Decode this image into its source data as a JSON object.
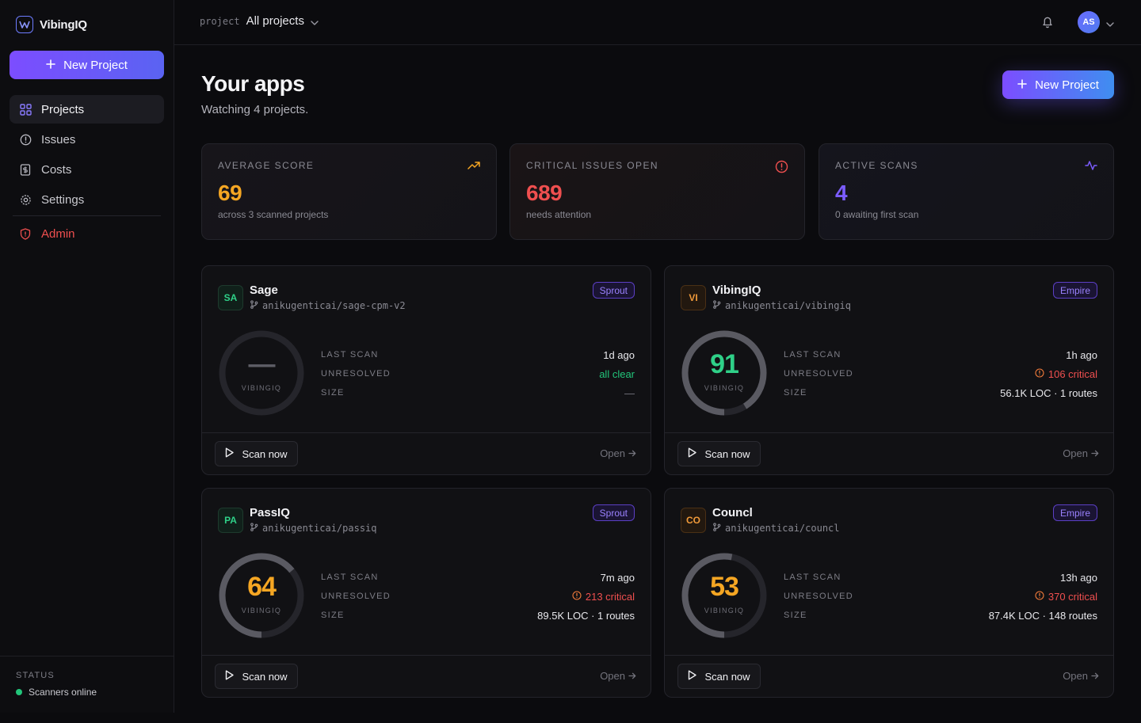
{
  "app": {
    "name": "VibingIQ"
  },
  "sidebar": {
    "new_project": "New Project",
    "items": [
      {
        "label": "Projects",
        "icon": "grid-icon",
        "active": true
      },
      {
        "label": "Issues",
        "icon": "alert-circle-icon"
      },
      {
        "label": "Costs",
        "icon": "receipt-icon"
      },
      {
        "label": "Settings",
        "icon": "gear-icon"
      }
    ],
    "admin": "Admin",
    "status": {
      "title": "STATUS",
      "text": "Scanners online"
    }
  },
  "topbar": {
    "project_label": "project",
    "project_value": "All projects",
    "avatar": "AS"
  },
  "header": {
    "title": "Your apps",
    "subtitle": "Watching 4 projects.",
    "new_project": "New Project"
  },
  "stats": [
    {
      "label": "AVERAGE SCORE",
      "value": "69",
      "sub": "across 3 scanned projects",
      "color": "#f5a623",
      "icon": "trending-up-icon"
    },
    {
      "label": "CRITICAL ISSUES OPEN",
      "value": "689",
      "sub": "needs attention",
      "color": "#ef4f4f",
      "icon": "alert-circle-icon"
    },
    {
      "label": "ACTIVE SCANS",
      "value": "4",
      "sub": "0 awaiting first scan",
      "color": "#7b5cff",
      "icon": "activity-icon"
    }
  ],
  "labels": {
    "last_scan": "LAST SCAN",
    "unresolved": "UNRESOLVED",
    "size": "SIZE",
    "gauge": "VIBINGIQ",
    "scan_now": "Scan now",
    "open": "Open"
  },
  "projects": [
    {
      "initials": "SA",
      "name": "Sage",
      "repo": "anikugenticai/sage-cpm-v2",
      "tier": "Sprout",
      "score": "—",
      "score_pct": 0,
      "last_scan": "1d ago",
      "unresolved": "all clear",
      "size": "—"
    },
    {
      "initials": "VI",
      "name": "VibingIQ",
      "repo": "anikugenticai/vibingiq",
      "tier": "Empire",
      "score": "91",
      "score_pct": 91,
      "last_scan": "1h ago",
      "unresolved": "106 critical",
      "size": "56.1K LOC · 1 routes"
    },
    {
      "initials": "PA",
      "name": "PassIQ",
      "repo": "anikugenticai/passiq",
      "tier": "Sprout",
      "score": "64",
      "score_pct": 64,
      "last_scan": "7m ago",
      "unresolved": "213 critical",
      "size": "89.5K LOC · 1 routes"
    },
    {
      "initials": "CO",
      "name": "Councl",
      "repo": "anikugenticai/councl",
      "tier": "Empire",
      "score": "53",
      "score_pct": 53,
      "last_scan": "13h ago",
      "unresolved": "370 critical",
      "size": "87.4K LOC · 148 routes"
    }
  ]
}
